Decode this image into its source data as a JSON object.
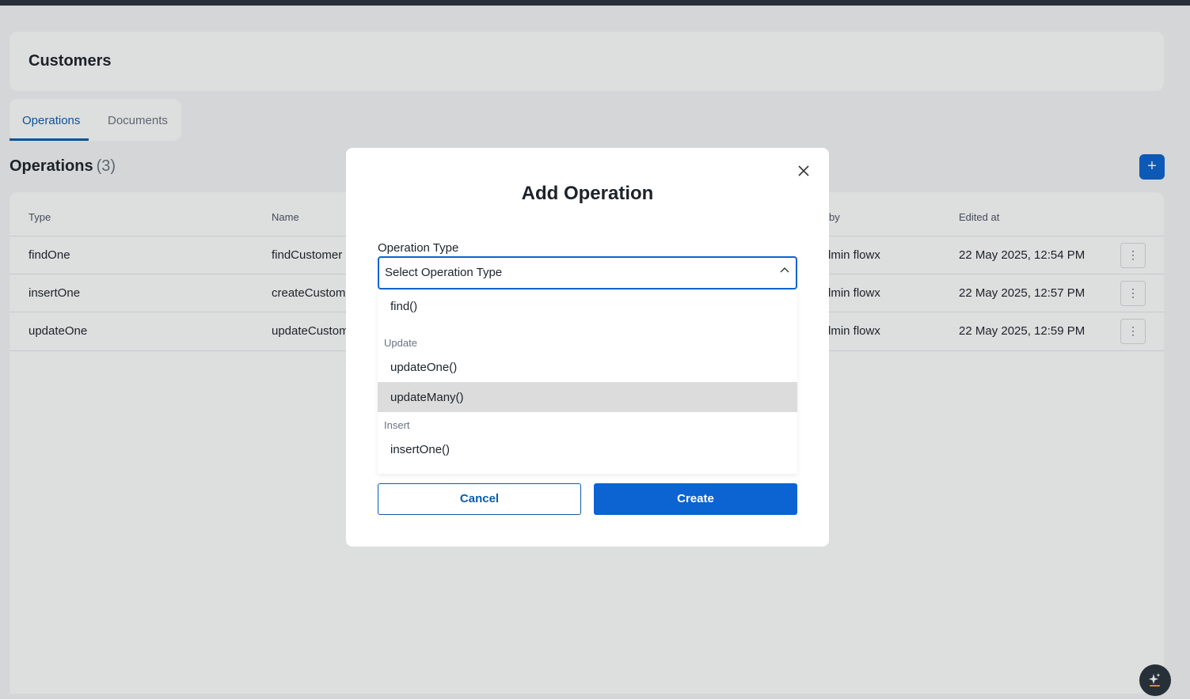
{
  "page": {
    "title": "Customers"
  },
  "tabs": [
    {
      "label": "Operations",
      "active": true
    },
    {
      "label": "Documents",
      "active": false
    }
  ],
  "operations": {
    "title": "Operations",
    "count": "(3)",
    "add_label": "+",
    "columns": [
      "Type",
      "Name",
      "by",
      "Edited at"
    ],
    "rows": [
      {
        "type": "findOne",
        "name": "findCustomer",
        "by": "dmin flowx",
        "edited_at": "22 May 2025, 12:54 PM"
      },
      {
        "type": "insertOne",
        "name": "createCustome",
        "by": "dmin flowx",
        "edited_at": "22 May 2025, 12:57 PM"
      },
      {
        "type": "updateOne",
        "name": "updateCustom",
        "by": "dmin flowx",
        "edited_at": "22 May 2025, 12:59 PM"
      }
    ]
  },
  "modal": {
    "title": "Add Operation",
    "close_icon": "close-icon",
    "field_label": "Operation Type",
    "select_value": "Select Operation Type",
    "dropdown": {
      "items": [
        {
          "kind": "option",
          "label": "find()"
        },
        {
          "kind": "group",
          "label": "Update"
        },
        {
          "kind": "option",
          "label": "updateOne()"
        },
        {
          "kind": "option",
          "label": "updateMany()",
          "hovered": true
        },
        {
          "kind": "group",
          "label": "Insert"
        },
        {
          "kind": "option",
          "label": "insertOne()"
        }
      ]
    },
    "cancel_label": "Cancel",
    "create_label": "Create"
  },
  "colors": {
    "primary": "#0b64d1",
    "topbar": "#2a333d",
    "hover": "#dcdcdc"
  }
}
